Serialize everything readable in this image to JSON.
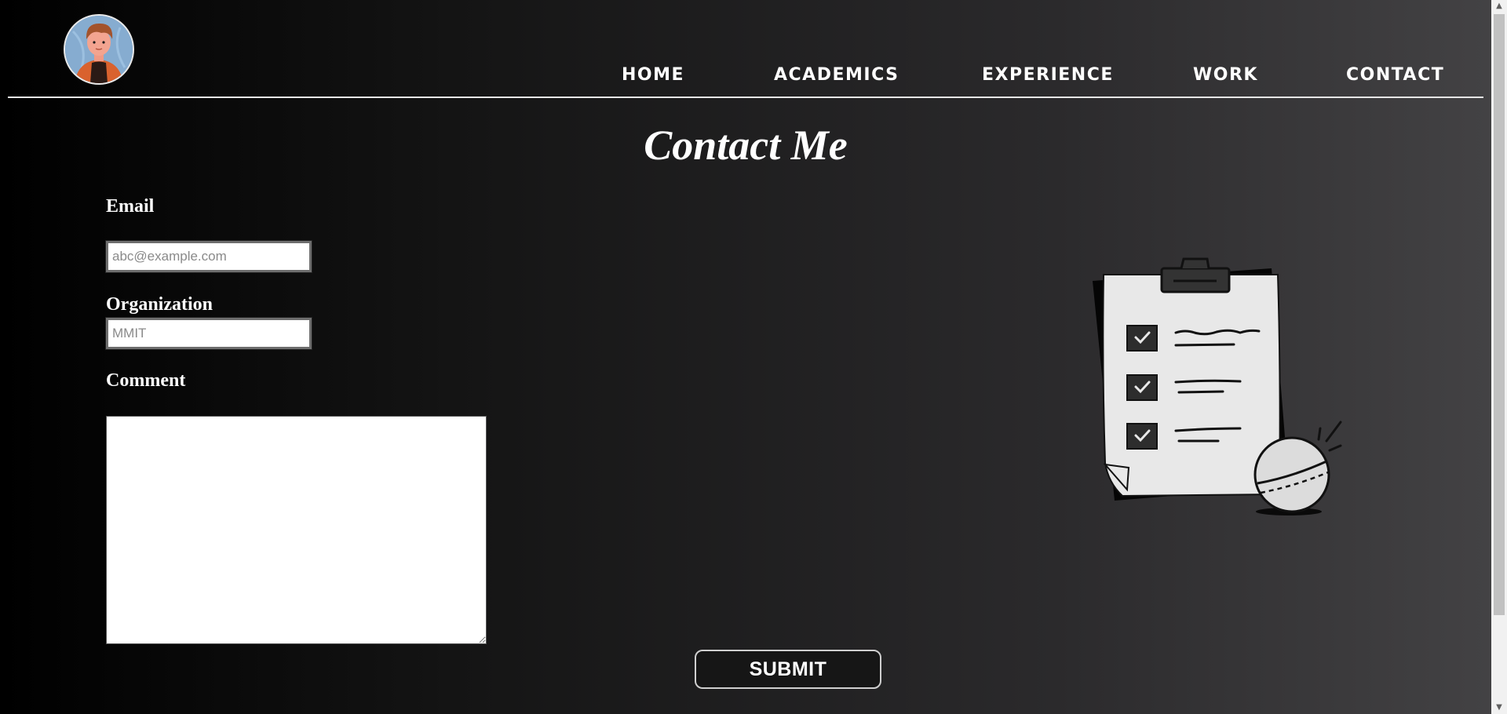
{
  "header": {
    "nav": [
      {
        "label": "HOME"
      },
      {
        "label": "ACADEMICS"
      },
      {
        "label": "EXPERIENCE"
      },
      {
        "label": "WORK"
      },
      {
        "label": "CONTACT"
      }
    ]
  },
  "main": {
    "title": "Contact Me",
    "form": {
      "email_label": "Email",
      "email_placeholder": "abc@example.com",
      "organization_label": "Organization",
      "organization_placeholder": "MMIT",
      "comment_label": "Comment",
      "submit_label": "SUBMIT"
    }
  },
  "illustration": {
    "icon": "clipboard-checklist-with-ball-icon"
  },
  "colors": {
    "background_start": "#000000",
    "background_end": "#444345",
    "text": "#ffffff",
    "input_bg": "#ffffff"
  }
}
